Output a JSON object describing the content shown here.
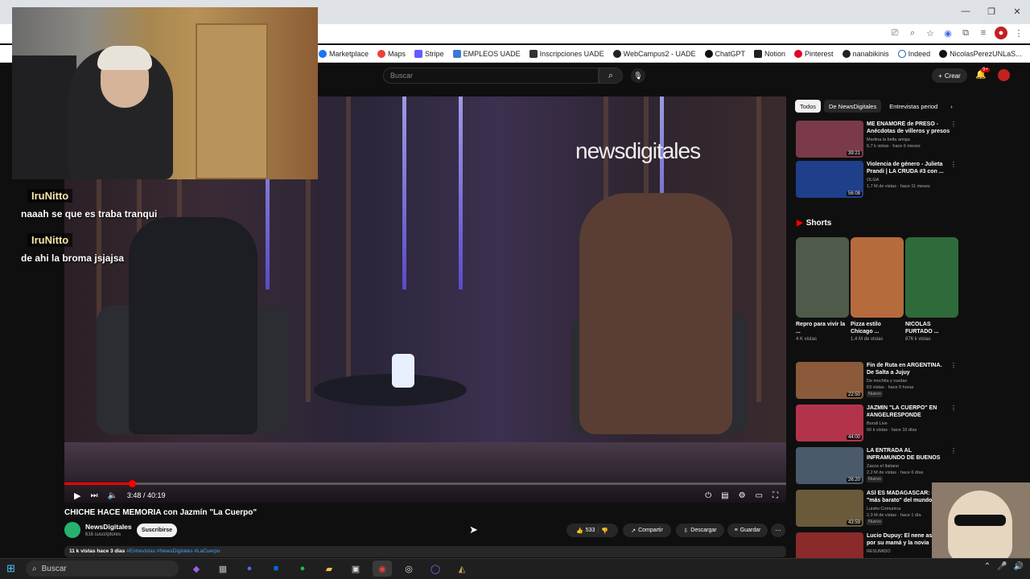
{
  "browser": {
    "bookmarks": [
      "Marketplace",
      "Maps",
      "Stripe",
      "EMPLEOS UADE",
      "Inscripciones UADE",
      "WebCampus2 - UADE",
      "ChatGPT",
      "Notion",
      "Pinterest",
      "nanabikinis",
      "Indeed",
      "NicolasPerezUNLaS..."
    ]
  },
  "header": {
    "search_placeholder": "Buscar",
    "create_label": "Crear",
    "notification_count": "9+"
  },
  "video": {
    "logo_text": "newsdigitales",
    "time": "3:48 / 40:19",
    "progress": 0.094,
    "title": "CHICHE HACE MEMORIA con Jazmín \"La Cuerpo\"",
    "channel": "NewsDigitales",
    "subscribers": "616 suscriptores",
    "subscribe_label": "Suscribirse",
    "likes": "533",
    "share_label": "Compartir",
    "download_label": "Descargar",
    "save_label": "Guardar",
    "desc_stats": "11 k vistas  hace 3 días",
    "desc_tags": "#Entrevistas #NewsDigitales #LaCuerpo"
  },
  "sidebar": {
    "chips": [
      "Todos",
      "De NewsDigitales",
      "Entrevistas period"
    ],
    "top_videos": [
      {
        "title": "ME ENAMORÉ de PRESO - Anécdotas de villeros y presos",
        "channel": "Martina la bella amiga",
        "meta": "6,7 k vistas · hace 6 meses",
        "duration": "39:21",
        "color": "#7a3a4a"
      },
      {
        "title": "Violencia de género - Julieta Prandi | LA CRUDA #3 con ...",
        "channel": "OLGA",
        "meta": "1,7 M de vistas · hace 11 meses",
        "duration": "56:08",
        "color": "#1f3f8a"
      }
    ],
    "shorts_label": "Shorts",
    "shorts": [
      {
        "title": "Repro para vivir la ...",
        "views": "4 K vistas",
        "color": "#4f5a4a"
      },
      {
        "title": "Pizza estilo Chicago ...",
        "views": "1,4 M de vistas",
        "color": "#b66b3c"
      },
      {
        "title": "NICOLAS FURTADO ...",
        "views": "876 k vistas",
        "color": "#2f6b3a"
      }
    ],
    "videos": [
      {
        "title": "Fin de Ruta en ARGENTINA. De Salta a Jujuy",
        "channel": "De mochila y ruedas",
        "meta": "63 vistas · hace 9 horas",
        "badge": "Nuevo",
        "duration": "22:50",
        "color": "#8a5a3a"
      },
      {
        "title": "JAZMÍN \"LA CUERPO\" EN #ANGELRESPONDE",
        "channel": "Bondi Live",
        "meta": "60 k vistas · hace 10 días",
        "badge": "",
        "duration": "44:00",
        "color": "#b3344a"
      },
      {
        "title": "LA ENTRADA AL INFRAMUNDO DE BUENOS AIRES - ¡Aquí NO ...",
        "channel": "Zazza el Italiano",
        "meta": "2,2 M de vistas · hace 6 días",
        "badge": "Nuevo",
        "duration": "26:20",
        "color": "#4a5a6a"
      },
      {
        "title": "ASÍ ES MADAGASCAR: el \"más barato\" del mundo | ...",
        "channel": "Luisito Comunica",
        "meta": "2,3 M de vistas · hace 1 día",
        "badge": "Nuevo",
        "duration": "43:59",
        "color": "#6a5a3a"
      },
      {
        "title": "Lucio Dupuy: El nene asesi por su mamá y la novia",
        "channel": "RESUMIDO",
        "meta": "",
        "badge": "",
        "duration": "",
        "color": "#8a2a2a"
      }
    ]
  },
  "chat": [
    {
      "user": "IruNitto",
      "message": "naaah se que es traba tranqui"
    },
    {
      "user": "IruNitto",
      "message": "de ahi la broma jsjajsa"
    }
  ],
  "taskbar": {
    "search_label": "Buscar"
  }
}
